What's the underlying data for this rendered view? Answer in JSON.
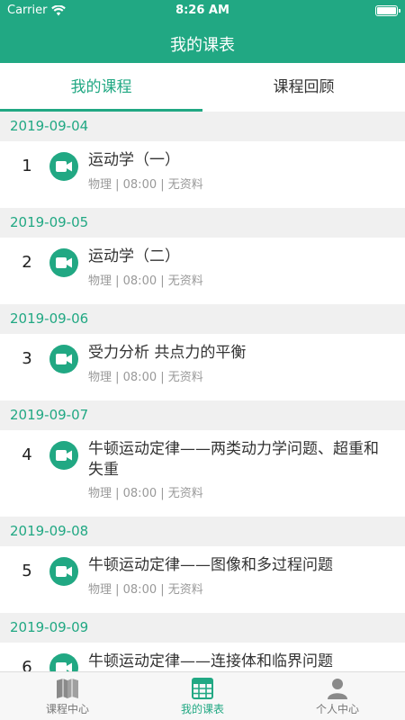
{
  "status_bar": {
    "carrier": "Carrier",
    "time": "8:26 AM"
  },
  "nav": {
    "title": "我的课表"
  },
  "tabs": [
    {
      "label": "我的课程",
      "active": true
    },
    {
      "label": "课程回顾",
      "active": false
    }
  ],
  "days": [
    {
      "date": "2019-09-04",
      "num": "1",
      "title": "运动学（一）",
      "meta": "物理 | 08:00 | 无资料"
    },
    {
      "date": "2019-09-05",
      "num": "2",
      "title": "运动学（二）",
      "meta": "物理 | 08:00 | 无资料"
    },
    {
      "date": "2019-09-06",
      "num": "3",
      "title": "受力分析 共点力的平衡",
      "meta": "物理 | 08:00 | 无资料"
    },
    {
      "date": "2019-09-07",
      "num": "4",
      "title": "牛顿运动定律——两类动力学问题、超重和失重",
      "meta": "物理 | 08:00 | 无资料"
    },
    {
      "date": "2019-09-08",
      "num": "5",
      "title": "牛顿运动定律——图像和多过程问题",
      "meta": "物理 | 08:00 | 无资料"
    },
    {
      "date": "2019-09-09",
      "num": "6",
      "title": "牛顿运动定律——连接体和临界问题",
      "meta": ""
    }
  ],
  "tabbar": [
    {
      "label": "课程中心",
      "icon": "book-icon",
      "active": false
    },
    {
      "label": "我的课表",
      "icon": "calendar-grid-icon",
      "active": true
    },
    {
      "label": "个人中心",
      "icon": "person-icon",
      "active": false
    }
  ],
  "colors": {
    "accent": "#21a883",
    "header_text": "#ffffff",
    "meta_text": "#999999"
  }
}
